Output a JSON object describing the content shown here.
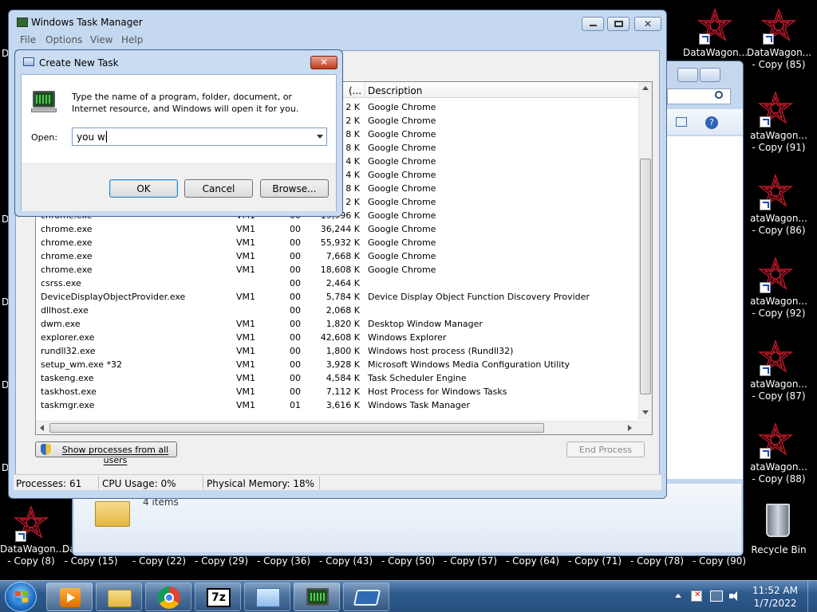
{
  "desktop": {
    "right_icons": [
      {
        "line1": "DataWagon...",
        "line2": ""
      },
      {
        "line1": "DataWagon...",
        "line2": "- Copy (85)"
      },
      {
        "line1": "ataWagon...",
        "line2": "- Copy (91)"
      },
      {
        "line1": "ataWagon...",
        "line2": "- Copy (86)"
      },
      {
        "line1": "ataWagon...",
        "line2": "- Copy (92)"
      },
      {
        "line1": "ataWagon...",
        "line2": "- Copy (87)"
      },
      {
        "line1": "ataWagon...",
        "line2": "- Copy (88)"
      }
    ],
    "bottom_icons": [
      {
        "line1": "DataWagon....",
        "line2": "- Copy (8)"
      },
      {
        "line1": "DataWagon.",
        "line2": "- Copy (15)"
      }
    ],
    "bottom_labels": [
      "- Copy (22)",
      "- Copy (29)",
      "- Copy (36)",
      "- Copy (43)",
      "- Copy (50)",
      "- Copy (57)",
      "- Copy (64)",
      "- Copy (71)",
      "- Copy (78)",
      "- Copy (90)"
    ],
    "recycle_bin": "Recycle Bin",
    "edge_letters": [
      "D",
      "D",
      "D",
      "D",
      "D"
    ],
    "bg_window_status": "4 items"
  },
  "task_manager": {
    "title": "Windows Task Manager",
    "menu": [
      "File",
      "Options",
      "View",
      "Help"
    ],
    "column_partial": "(...",
    "column_description": "Description",
    "hidden_rows": [
      {
        "mem": "2 K",
        "desc": "Google Chrome"
      },
      {
        "mem": "2 K",
        "desc": "Google Chrome"
      },
      {
        "mem": "8 K",
        "desc": "Google Chrome"
      },
      {
        "mem": "8 K",
        "desc": "Google Chrome"
      },
      {
        "mem": "4 K",
        "desc": "Google Chrome"
      },
      {
        "mem": "4 K",
        "desc": "Google Chrome"
      },
      {
        "mem": "8 K",
        "desc": "Google Chrome"
      },
      {
        "mem": "2 K",
        "desc": "Google Chrome"
      }
    ],
    "rows": [
      {
        "name": "chrome.exe",
        "user": "VM1",
        "cpu": "00",
        "mem": "19,996 K",
        "desc": "Google Chrome"
      },
      {
        "name": "chrome.exe",
        "user": "VM1",
        "cpu": "00",
        "mem": "36,244 K",
        "desc": "Google Chrome"
      },
      {
        "name": "chrome.exe",
        "user": "VM1",
        "cpu": "00",
        "mem": "55,932 K",
        "desc": "Google Chrome"
      },
      {
        "name": "chrome.exe",
        "user": "VM1",
        "cpu": "00",
        "mem": "7,668 K",
        "desc": "Google Chrome"
      },
      {
        "name": "chrome.exe",
        "user": "VM1",
        "cpu": "00",
        "mem": "18,608 K",
        "desc": "Google Chrome"
      },
      {
        "name": "csrss.exe",
        "user": "",
        "cpu": "00",
        "mem": "2,464 K",
        "desc": ""
      },
      {
        "name": "DeviceDisplayObjectProvider.exe",
        "user": "VM1",
        "cpu": "00",
        "mem": "5,784 K",
        "desc": "Device Display Object Function Discovery Provider"
      },
      {
        "name": "dllhost.exe",
        "user": "",
        "cpu": "00",
        "mem": "2,068 K",
        "desc": ""
      },
      {
        "name": "dwm.exe",
        "user": "VM1",
        "cpu": "00",
        "mem": "1,820 K",
        "desc": "Desktop Window Manager"
      },
      {
        "name": "explorer.exe",
        "user": "VM1",
        "cpu": "00",
        "mem": "42,608 K",
        "desc": "Windows Explorer"
      },
      {
        "name": "rundll32.exe",
        "user": "VM1",
        "cpu": "00",
        "mem": "1,800 K",
        "desc": "Windows host process (Rundll32)"
      },
      {
        "name": "setup_wm.exe *32",
        "user": "VM1",
        "cpu": "00",
        "mem": "3,928 K",
        "desc": "Microsoft Windows Media Configuration Utility"
      },
      {
        "name": "taskeng.exe",
        "user": "VM1",
        "cpu": "00",
        "mem": "4,584 K",
        "desc": "Task Scheduler Engine"
      },
      {
        "name": "taskhost.exe",
        "user": "VM1",
        "cpu": "00",
        "mem": "7,112 K",
        "desc": "Host Process for Windows Tasks"
      },
      {
        "name": "taskmgr.exe",
        "user": "VM1",
        "cpu": "01",
        "mem": "3,616 K",
        "desc": "Windows Task Manager"
      }
    ],
    "show_all_label": "Show processes from all users",
    "end_process_label": "End Process",
    "status": {
      "processes": "Processes: 61",
      "cpu": "CPU Usage: 0%",
      "memory": "Physical Memory: 18%"
    }
  },
  "dialog": {
    "title": "Create New Task",
    "description": "Type the name of a program, folder, document, or Internet resource, and Windows will open it for you.",
    "open_label": "Open:",
    "open_value": "you wi",
    "ok": "OK",
    "cancel": "Cancel",
    "browse": "Browse..."
  },
  "taskbar": {
    "time": "11:52 AM",
    "date": "1/7/2022",
    "apps": [
      "media-player-icon",
      "explorer-icon",
      "chrome-icon",
      "7zip-icon",
      "control-panel-icon",
      "task-manager-icon",
      "app-window-icon"
    ]
  }
}
